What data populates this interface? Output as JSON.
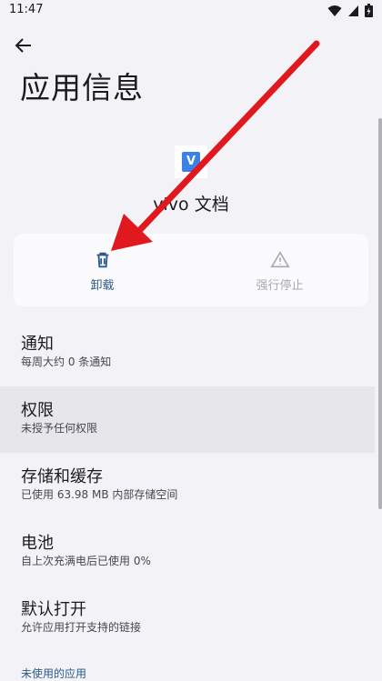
{
  "status": {
    "time": "11:47"
  },
  "header": {
    "title": "应用信息"
  },
  "app": {
    "name": "vivo 文档",
    "icon_text": "V"
  },
  "actions": {
    "uninstall": "卸载",
    "force_stop": "强行停止"
  },
  "items": [
    {
      "title": "通知",
      "subtitle": "每周大约 0 条通知"
    },
    {
      "title": "权限",
      "subtitle": "未授予任何权限"
    },
    {
      "title": "存储和缓存",
      "subtitle": "已使用 63.98 MB 内部存储空间"
    },
    {
      "title": "电池",
      "subtitle": "自上次充满电后已使用 0%"
    },
    {
      "title": "默认打开",
      "subtitle": "允许应用打开支持的链接"
    }
  ],
  "section": {
    "unused_apps": "未使用的应用"
  },
  "colors": {
    "accent": "#2b5a8a",
    "annotation_arrow": "#e0191e"
  },
  "icons": [
    "back-arrow-icon",
    "trash-icon",
    "warning-icon",
    "wifi-icon",
    "signal-icon",
    "battery-icon"
  ]
}
